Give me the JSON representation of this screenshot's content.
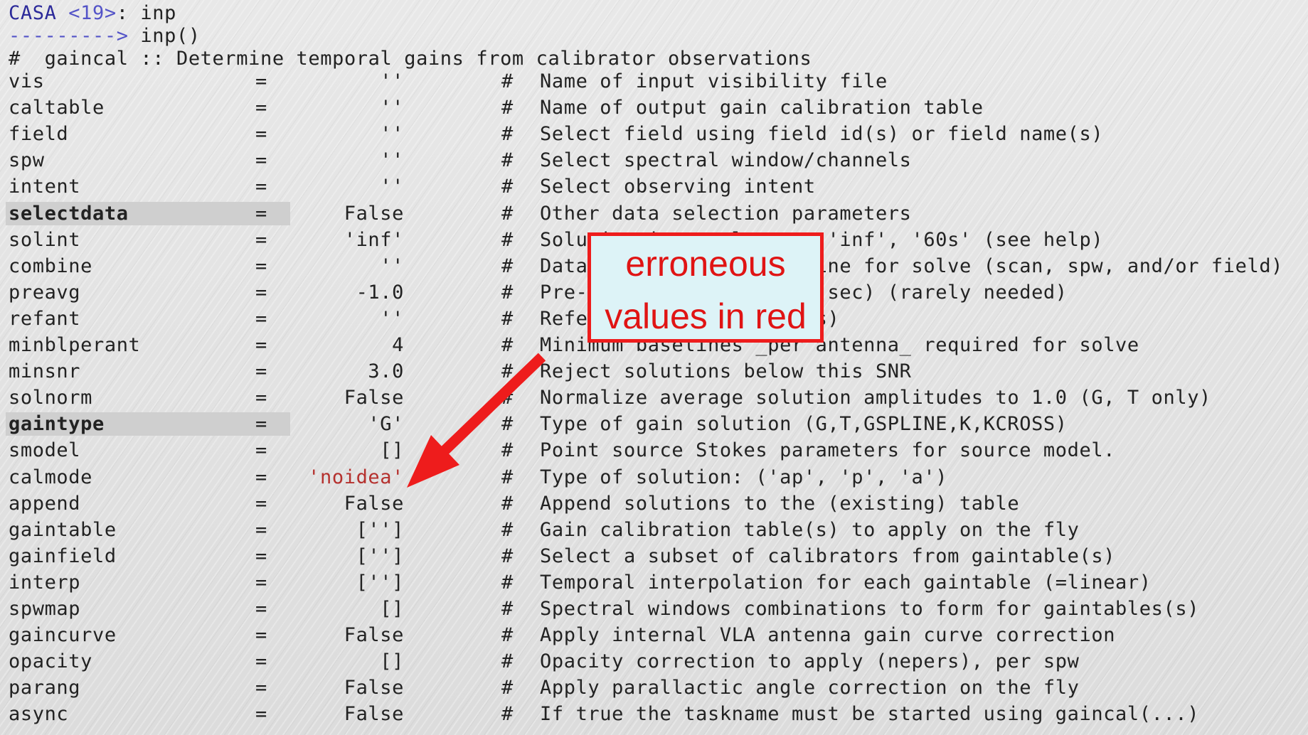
{
  "prompt": {
    "casa": "CASA ",
    "count": "<19>",
    "suffix": ": inp",
    "arrow": "--------->",
    "call": " inp()"
  },
  "header": "#  gaincal :: Determine temporal gains from calibrator observations",
  "hash_symbol": "#",
  "equals_symbol": "=",
  "params": [
    {
      "name": "vis",
      "value": "''",
      "comment": "Name of input visibility file"
    },
    {
      "name": "caltable",
      "value": "''",
      "comment": "Name of output gain calibration table"
    },
    {
      "name": "field",
      "value": "''",
      "comment": "Select field using field id(s) or field name(s)"
    },
    {
      "name": "spw",
      "value": "''",
      "comment": "Select spectral window/channels"
    },
    {
      "name": "intent",
      "value": "''",
      "comment": "Select observing intent"
    },
    {
      "name": "selectdata",
      "value": "False",
      "comment": "Other data selection parameters",
      "highlight": true
    },
    {
      "name": "solint",
      "value": "'inf'",
      "comment": "Solution interval: egs. 'inf', '60s' (see help)"
    },
    {
      "name": "combine",
      "value": "''",
      "comment": "Data axes which to combine for solve (scan, spw, and/or field)"
    },
    {
      "name": "preavg",
      "value": "-1.0",
      "comment": "Pre-averaging interval (sec) (rarely needed)"
    },
    {
      "name": "refant",
      "value": "''",
      "comment": "Reference antenna name(s)"
    },
    {
      "name": "minblperant",
      "value": "4",
      "comment": "Minimum baselines _per antenna_ required for solve"
    },
    {
      "name": "minsnr",
      "value": "3.0",
      "comment": "Reject solutions below this SNR"
    },
    {
      "name": "solnorm",
      "value": "False",
      "comment": "Normalize average solution amplitudes to 1.0 (G, T only)"
    },
    {
      "name": "gaintype",
      "value": "'G'",
      "comment": "Type of gain solution (G,T,GSPLINE,K,KCROSS)",
      "highlight": true
    },
    {
      "name": "smodel",
      "value": "[]",
      "comment": "Point source Stokes parameters for source model."
    },
    {
      "name": "calmode",
      "value": "'noidea'",
      "comment": "Type of solution: ('ap', 'p', 'a')",
      "error": true
    },
    {
      "name": "append",
      "value": "False",
      "comment": "Append solutions to the (existing) table"
    },
    {
      "name": "gaintable",
      "value": "['']",
      "comment": "Gain calibration table(s) to apply on the fly"
    },
    {
      "name": "gainfield",
      "value": "['']",
      "comment": "Select a subset of calibrators from gaintable(s)"
    },
    {
      "name": "interp",
      "value": "['']",
      "comment": "Temporal interpolation for each gaintable (=linear)"
    },
    {
      "name": "spwmap",
      "value": "[]",
      "comment": "Spectral windows combinations to form for gaintables(s)"
    },
    {
      "name": "gaincurve",
      "value": "False",
      "comment": "Apply internal VLA antenna gain curve correction"
    },
    {
      "name": "opacity",
      "value": "[]",
      "comment": "Opacity correction to apply (nepers), per spw"
    },
    {
      "name": "parang",
      "value": "False",
      "comment": "Apply parallactic angle correction on the fly"
    },
    {
      "name": "async",
      "value": "False",
      "comment": "If true the taskname must be started using gaincal(...)"
    }
  ],
  "callout": {
    "line1": "erroneous",
    "line2": "values in red"
  },
  "colors": {
    "error": "#b5312e",
    "callout_border": "#ee1c1c",
    "callout_fill": "#ddf3f7",
    "prompt": "#2c2a9a"
  }
}
